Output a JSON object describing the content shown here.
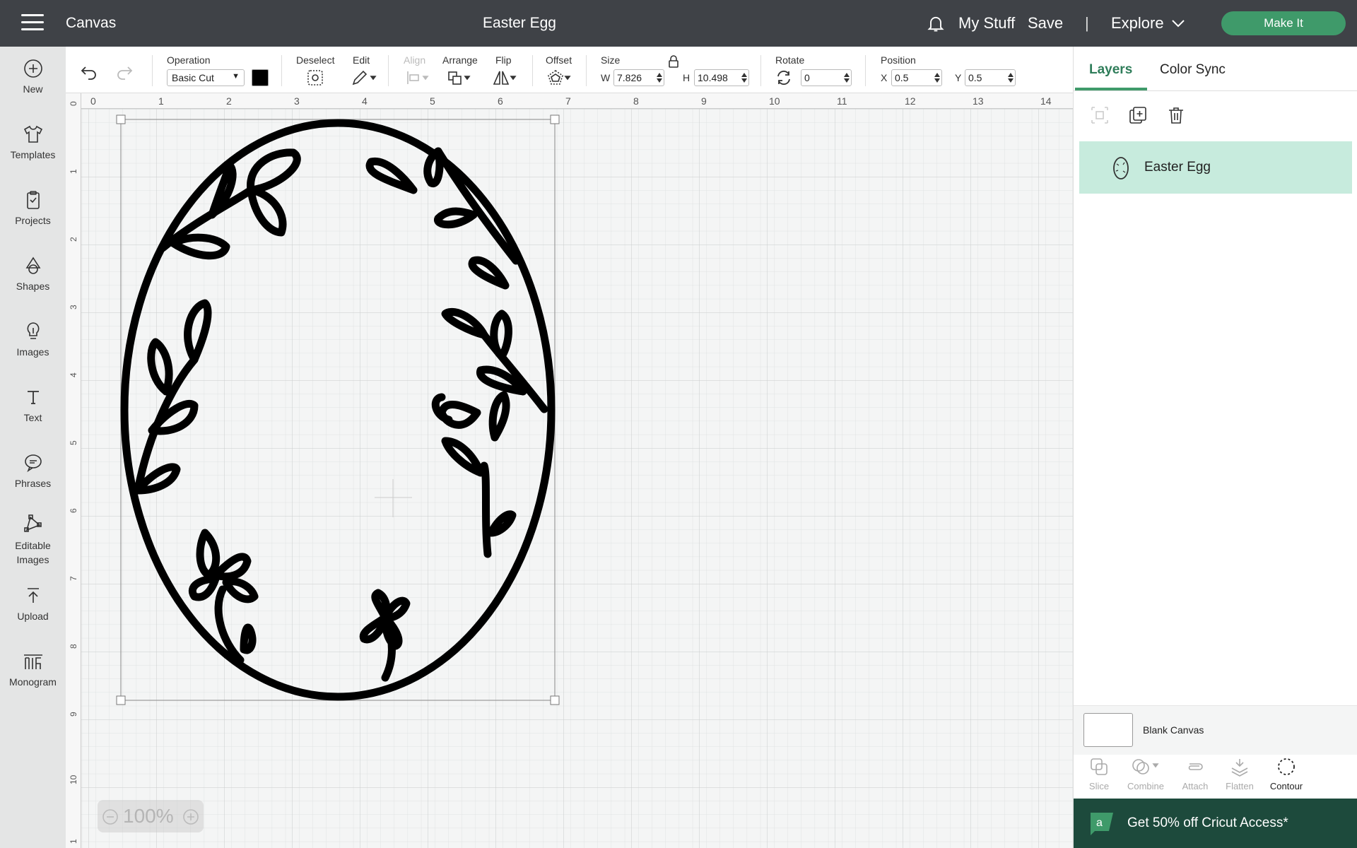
{
  "topbar": {
    "app_title": "Canvas",
    "doc_title": "Easter Egg",
    "mystuff": "My Stuff",
    "save": "Save",
    "divider": "|",
    "explore": "Explore",
    "makeit": "Make It"
  },
  "sidebar": {
    "items": [
      {
        "label": "New",
        "icon": "plus-circle-icon"
      },
      {
        "label": "Templates",
        "icon": "tshirt-icon"
      },
      {
        "label": "Projects",
        "icon": "clipboard-icon"
      },
      {
        "label": "Shapes",
        "icon": "shapes-icon"
      },
      {
        "label": "Images",
        "icon": "lightbulb-icon"
      },
      {
        "label": "Text",
        "icon": "text-icon"
      },
      {
        "label": "Phrases",
        "icon": "speech-bubble-icon"
      },
      {
        "label": "Editable Images",
        "icon": "editable-images-icon"
      },
      {
        "label": "Upload",
        "icon": "upload-icon"
      },
      {
        "label": "Monogram",
        "icon": "monogram-icon"
      }
    ]
  },
  "toolbar": {
    "operation_label": "Operation",
    "operation_value": "Basic Cut",
    "color": "#000000",
    "deselect_label": "Deselect",
    "edit_label": "Edit",
    "align_label": "Align",
    "arrange_label": "Arrange",
    "flip_label": "Flip",
    "offset_label": "Offset",
    "size_label": "Size",
    "w_label": "W",
    "w_value": "7.826",
    "h_label": "H",
    "h_value": "10.498",
    "rotate_label": "Rotate",
    "rotate_value": "0",
    "position_label": "Position",
    "x_label": "X",
    "x_value": "0.5",
    "y_label": "Y",
    "y_value": "0.5"
  },
  "canvas": {
    "ruler_top": [
      "0",
      "1",
      "2",
      "3",
      "4",
      "5",
      "6",
      "7",
      "8",
      "9",
      "10",
      "11",
      "12",
      "13",
      "14"
    ],
    "ruler_left": [
      "0",
      "1",
      "2",
      "3",
      "4",
      "5",
      "6",
      "7",
      "8",
      "9",
      "10",
      "1"
    ],
    "zoom_value": "100%"
  },
  "rightpanel": {
    "tab_layers": "Layers",
    "tab_colorsync": "Color Sync",
    "layer_name": "Easter Egg",
    "blank_canvas": "Blank Canvas",
    "bottom_tools": [
      "Slice",
      "Combine",
      "Attach",
      "Flatten",
      "Contour"
    ],
    "promo_text": "Get 50% off Cricut Access*"
  },
  "colors": {
    "topbar_bg": "#3f4247",
    "accent": "#3f9a6a",
    "layer_selected": "#c7ebdd",
    "promo_bg": "#1d4a3c"
  }
}
